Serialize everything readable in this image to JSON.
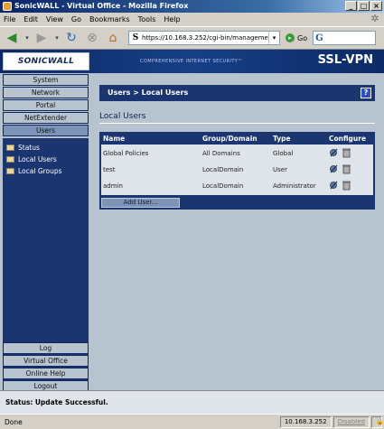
{
  "window": {
    "title": "SonicWALL - Virtual Office - Mozilla Firefox",
    "controls": [
      "_",
      "□",
      "×"
    ]
  },
  "menu": [
    "File",
    "Edit",
    "View",
    "Go",
    "Bookmarks",
    "Tools",
    "Help"
  ],
  "navbar": {
    "url": "https://10.168.3.252/cgi-bin/management",
    "search_placeholder": ""
  },
  "banner": {
    "logo": "SONICWALL",
    "tagline": "COMPREHENSIVE INTERNET SECURITY™",
    "product": "SSL-VPN"
  },
  "sidebar": {
    "top_items": [
      {
        "label": "System",
        "active": false
      },
      {
        "label": "Network",
        "active": false
      },
      {
        "label": "Portal",
        "active": false
      },
      {
        "label": "NetExtender",
        "active": false
      },
      {
        "label": "Users",
        "active": true
      }
    ],
    "tree": [
      "Status",
      "Local Users",
      "Local Groups"
    ],
    "bottom_items": [
      "Log",
      "Virtual Office",
      "Online Help",
      "Logout"
    ]
  },
  "main": {
    "breadcrumb": "Users > Local Users",
    "help": "?",
    "title": "Local Users",
    "columns": [
      "Name",
      "Group/Domain",
      "Type",
      "Configure"
    ],
    "rows": [
      {
        "name": "Global Policies",
        "group": "All Domains",
        "type": "Global"
      },
      {
        "name": "test",
        "group": "LocalDomain",
        "type": "User"
      },
      {
        "name": "admin",
        "group": "LocalDomain",
        "type": "Administrator"
      }
    ],
    "add_button": "Add User..."
  },
  "status": {
    "label": "Status:",
    "message": "Update Successful."
  },
  "browser_status": {
    "left": "Done",
    "ip": "10.168.3.252",
    "popup": "Disabled"
  }
}
